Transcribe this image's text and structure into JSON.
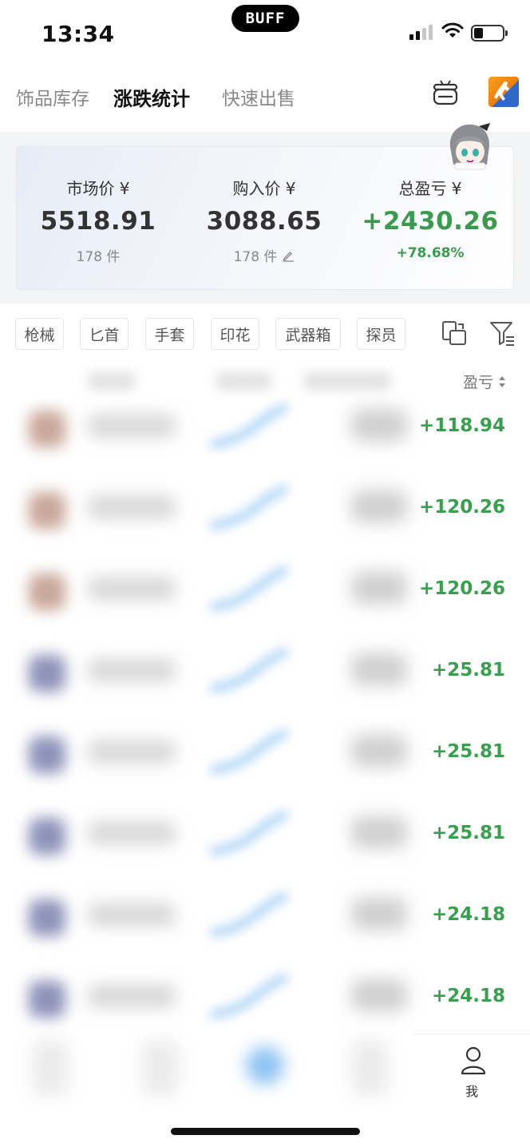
{
  "status_bar": {
    "time": "13:34",
    "island_text": "BUFF"
  },
  "top_tabs": {
    "inventory": "饰品库存",
    "stats": "涨跌统计",
    "quick_sell": "快速出售",
    "active": "stats"
  },
  "summary": {
    "market": {
      "label": "市场价 ¥",
      "value": "5518.91",
      "count": "178 件"
    },
    "purchase": {
      "label": "购入价 ¥",
      "value": "3088.65",
      "count": "178 件"
    },
    "profit": {
      "label": "总盈亏 ¥",
      "value": "+2430.26",
      "percent": "+78.68%"
    }
  },
  "categories": [
    "枪械",
    "匕首",
    "手套",
    "印花",
    "武器箱",
    "探员"
  ],
  "table": {
    "sort_label": "盈亏",
    "rows": [
      {
        "profit": "+118.94",
        "thumb_color": "#c9a79a"
      },
      {
        "profit": "+120.26",
        "thumb_color": "#c9a79a"
      },
      {
        "profit": "+120.26",
        "thumb_color": "#c9a79a"
      },
      {
        "profit": "+25.81",
        "thumb_color": "#8e92b8"
      },
      {
        "profit": "+25.81",
        "thumb_color": "#8e92b8"
      },
      {
        "profit": "+25.81",
        "thumb_color": "#8e92b8"
      },
      {
        "profit": "+24.18",
        "thumb_color": "#8e92b8"
      },
      {
        "profit": "+24.18",
        "thumb_color": "#8e92b8"
      }
    ]
  },
  "bottom_nav": {
    "me_label": "我"
  },
  "colors": {
    "profit_green": "#36a04c",
    "accent_blue": "#8fc4f2"
  }
}
